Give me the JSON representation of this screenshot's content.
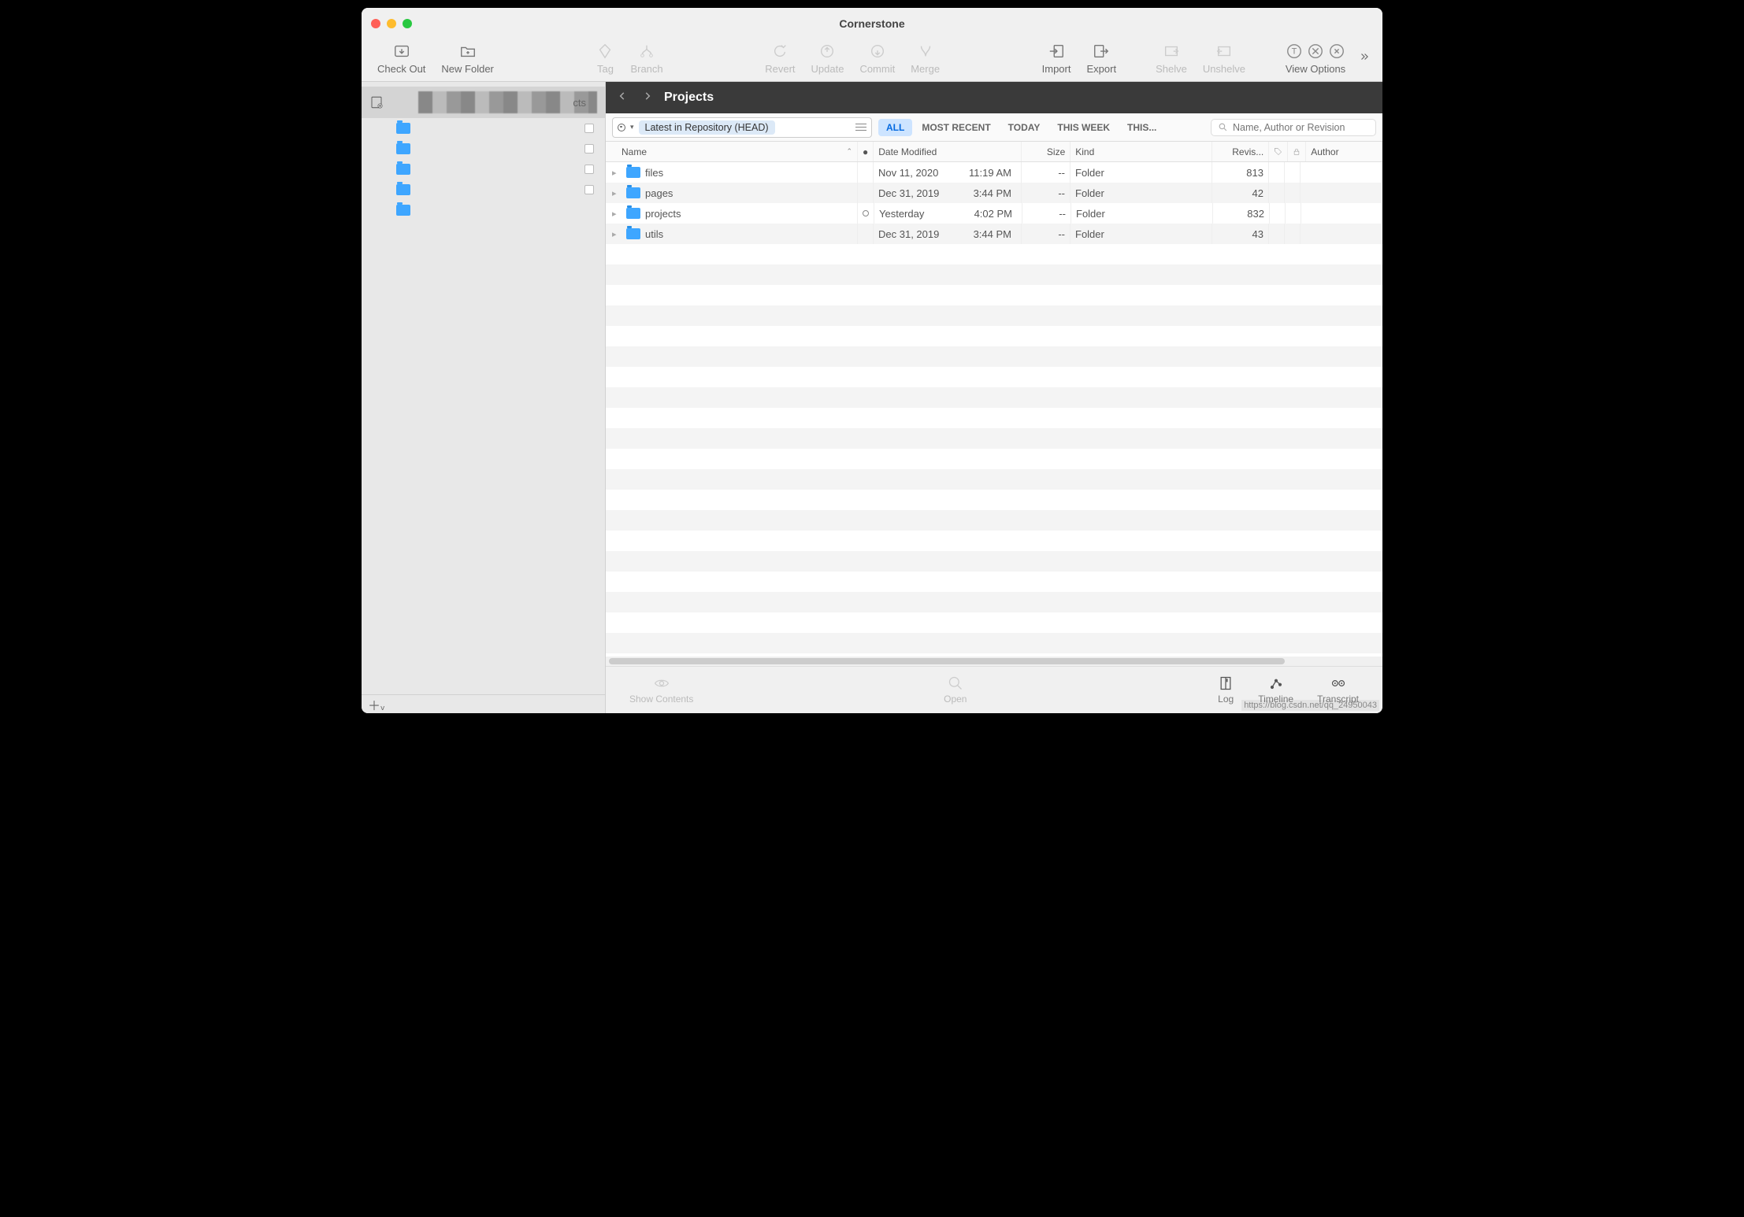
{
  "app": {
    "title": "Cornerstone"
  },
  "toolbar": {
    "checkout": "Check Out",
    "newfolder": "New Folder",
    "tag": "Tag",
    "branch": "Branch",
    "revert": "Revert",
    "update": "Update",
    "commit": "Commit",
    "merge": "Merge",
    "import": "Import",
    "export": "Export",
    "shelve": "Shelve",
    "unshelve": "Unshelve",
    "viewoptions": "View Options"
  },
  "sidebar": {
    "repoSuffix": "cts"
  },
  "path": {
    "title": "Projects"
  },
  "filter": {
    "revision": "Latest in Repository (HEAD)",
    "tabs": {
      "all": "ALL",
      "recent": "MOST RECENT",
      "today": "TODAY",
      "week": "THIS WEEK",
      "this": "THIS..."
    },
    "searchPlaceholder": "Name, Author or Revision"
  },
  "headers": {
    "name": "Name",
    "date": "Date Modified",
    "size": "Size",
    "kind": "Kind",
    "rev": "Revis...",
    "author": "Author"
  },
  "rows": [
    {
      "name": "files",
      "dateA": "Nov 11, 2020",
      "dateB": "11:19 AM",
      "size": "--",
      "kind": "Folder",
      "rev": "813",
      "mod": false
    },
    {
      "name": "pages",
      "dateA": "Dec 31, 2019",
      "dateB": "3:44 PM",
      "size": "--",
      "kind": "Folder",
      "rev": "42",
      "mod": false
    },
    {
      "name": "projects",
      "dateA": "Yesterday",
      "dateB": "4:02 PM",
      "size": "--",
      "kind": "Folder",
      "rev": "832",
      "mod": true
    },
    {
      "name": "utils",
      "dateA": "Dec 31, 2019",
      "dateB": "3:44 PM",
      "size": "--",
      "kind": "Folder",
      "rev": "43",
      "mod": false
    }
  ],
  "bottom": {
    "show": "Show Contents",
    "open": "Open",
    "log": "Log",
    "timeline": "Timeline",
    "transcript": "Transcript"
  },
  "watermark": "https://blog.csdn.net/qq_24950043"
}
